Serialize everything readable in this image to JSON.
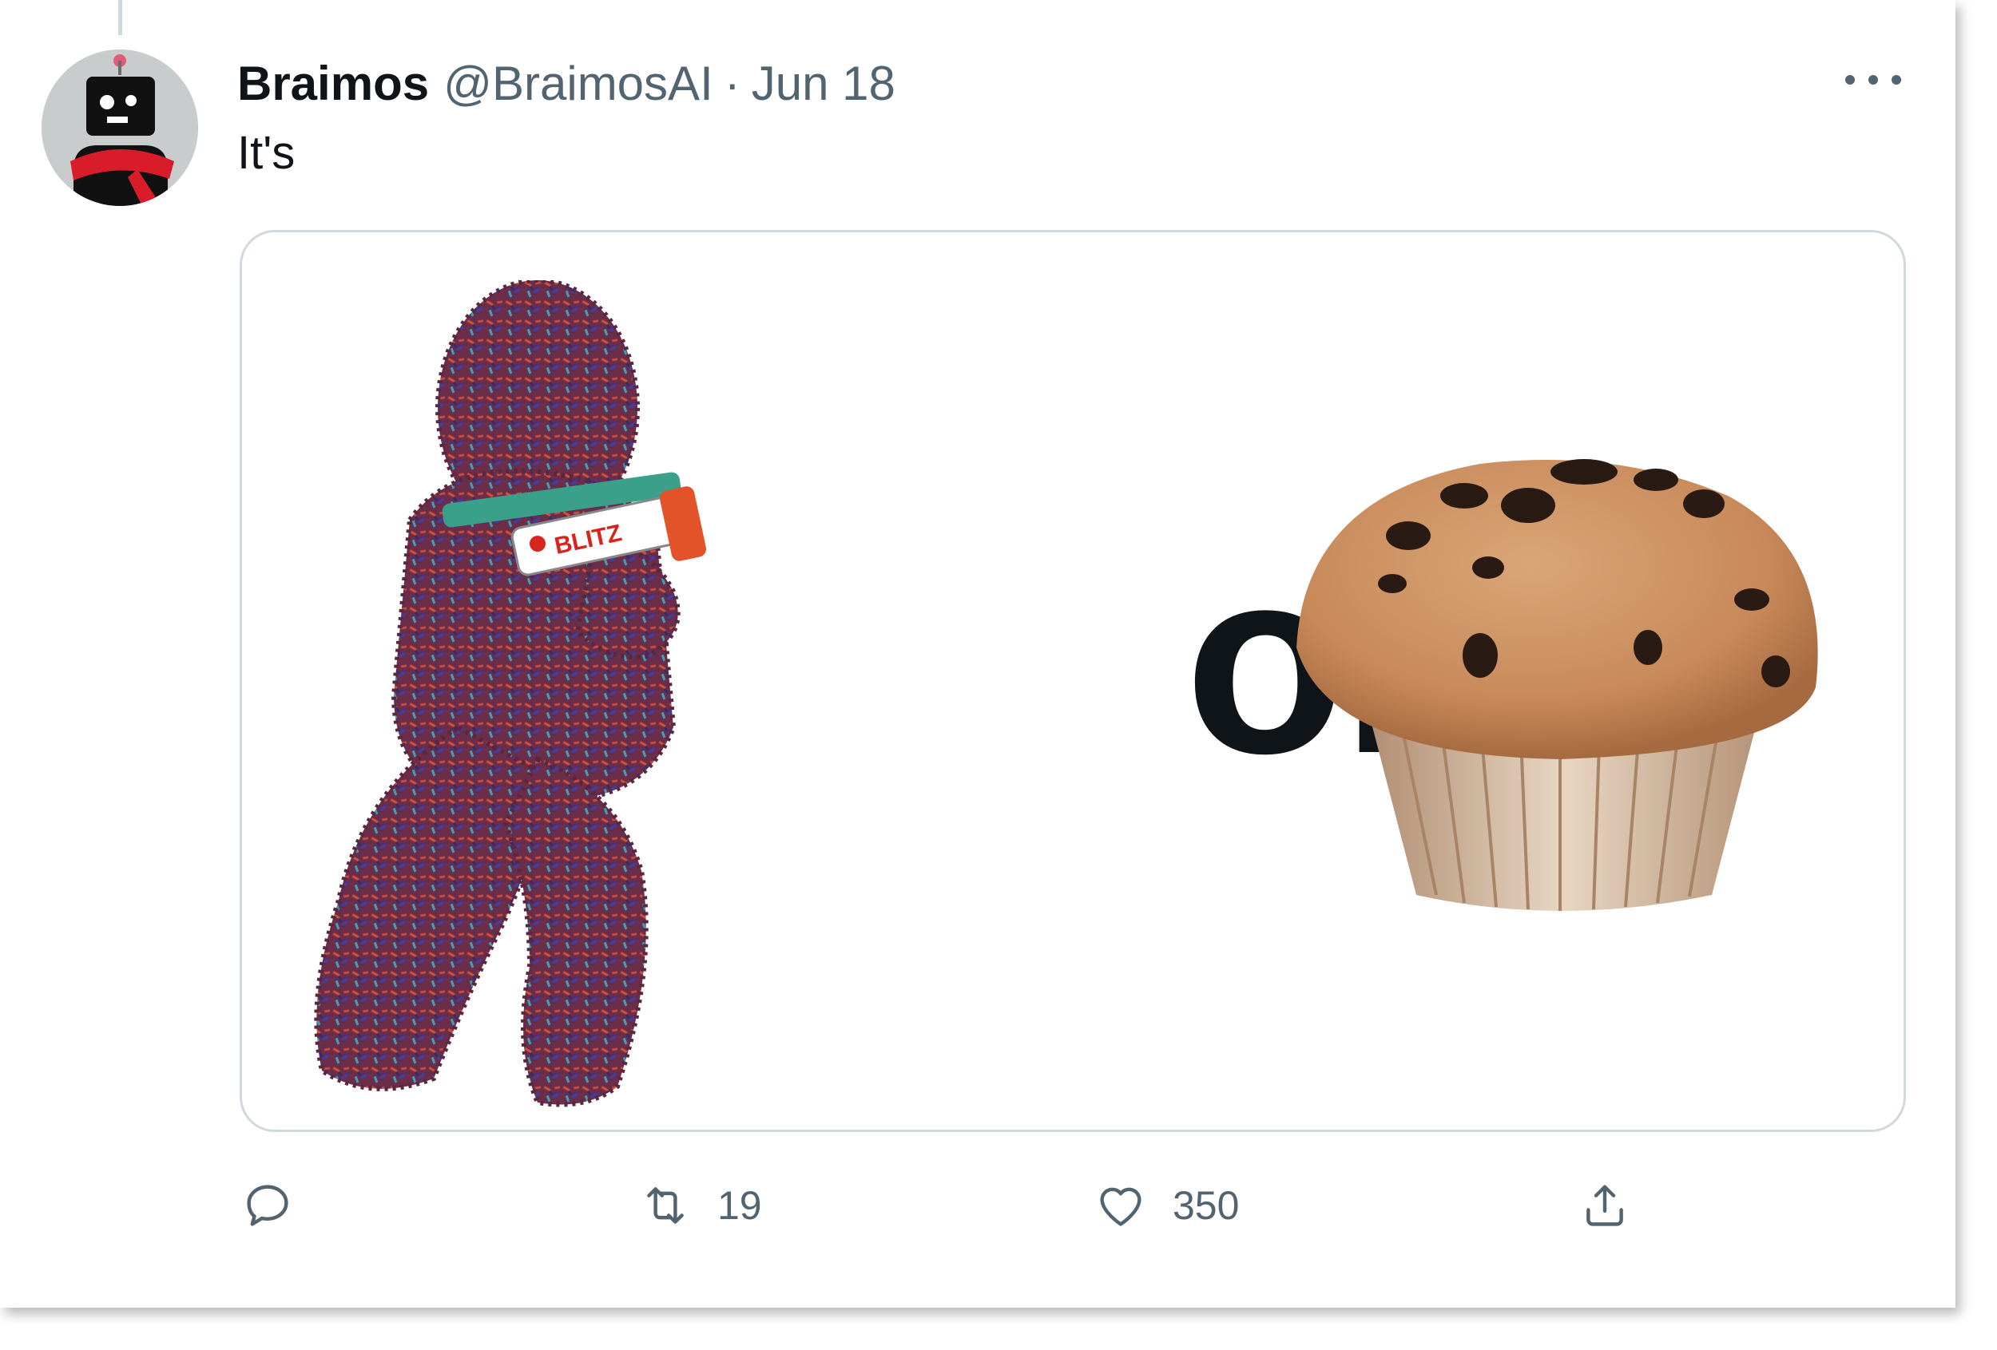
{
  "tweet": {
    "author_name": "Braimos",
    "author_handle": "@BraimosAI",
    "separator": "·",
    "date": "Jun 18",
    "text": "It's",
    "media": {
      "divider_text": "or",
      "left_image": "fuzzy-creature-with-blaster",
      "right_image": "chocolate-chip-muffin",
      "blaster_label": "BLITZ"
    }
  },
  "actions": {
    "reply": {
      "icon": "reply-icon",
      "count": ""
    },
    "retweet": {
      "icon": "retweet-icon",
      "count": "19"
    },
    "like": {
      "icon": "heart-icon",
      "count": "350"
    },
    "share": {
      "icon": "share-icon",
      "count": ""
    }
  },
  "colors": {
    "text_primary": "#0f1419",
    "text_secondary": "#536471",
    "border": "#cfd9de"
  }
}
